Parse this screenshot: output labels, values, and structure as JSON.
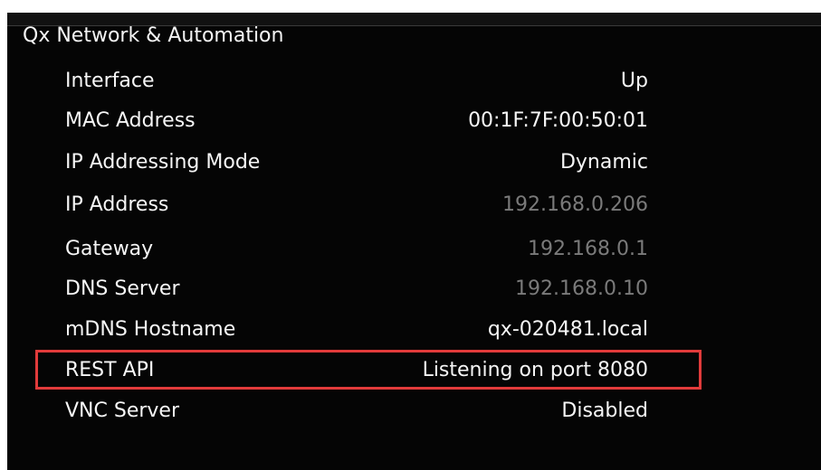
{
  "colors": {
    "background": "#050505",
    "text": "#f6f6f6",
    "dim_text": "#7a7a7a",
    "highlight": "#e23b3b"
  },
  "panel": {
    "title": "Qx Network & Automation",
    "rows": [
      {
        "label": "Interface",
        "value": "Up",
        "dim": false
      },
      {
        "label": "MAC Address",
        "value": "00:1F:7F:00:50:01",
        "dim": false
      },
      {
        "label": "IP Addressing Mode",
        "value": "Dynamic",
        "dim": false
      },
      {
        "label": "IP Address",
        "value": "192.168.0.206",
        "dim": true
      },
      {
        "label": "Gateway",
        "value": "192.168.0.1",
        "dim": true
      },
      {
        "label": "DNS Server",
        "value": "192.168.0.10",
        "dim": true
      },
      {
        "label": "mDNS Hostname",
        "value": "qx-020481.local",
        "dim": false
      },
      {
        "label": "REST API",
        "value": "Listening on port 8080",
        "dim": false,
        "highlighted": true
      },
      {
        "label": "VNC Server",
        "value": "Disabled",
        "dim": false
      }
    ]
  }
}
